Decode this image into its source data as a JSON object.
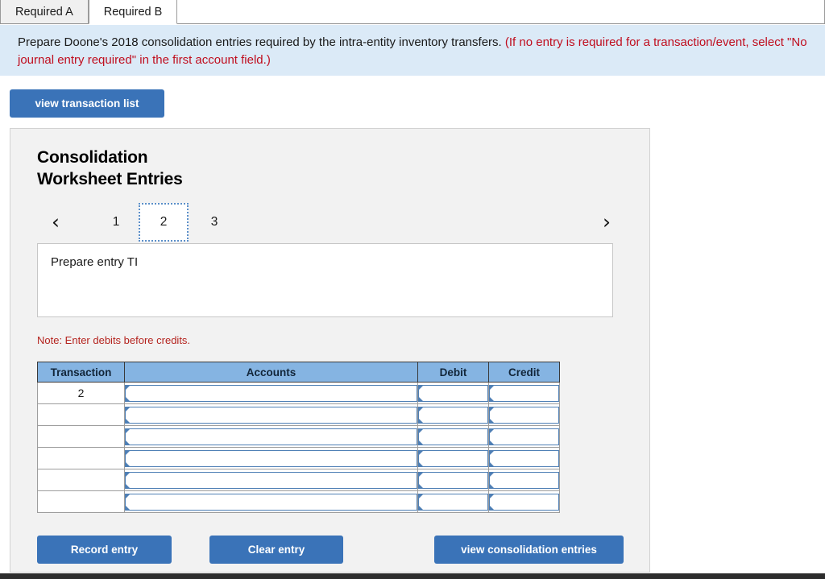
{
  "tabs": [
    {
      "label": "Required A",
      "active": false
    },
    {
      "label": "Required B",
      "active": true
    }
  ],
  "banner": {
    "black_text": "Prepare Doone's 2018 consolidation entries required by the intra-entity inventory transfers.",
    "red_text": "(If no entry is required for a transaction/event, select \"No journal entry required\" in the first account field.)"
  },
  "toolbar": {
    "view_transaction_list_label": "view transaction list"
  },
  "panel": {
    "title_line1": "Consolidation",
    "title_line2": "Worksheet Entries",
    "pager": {
      "prev_icon": "chevron-left-icon",
      "next_icon": "chevron-right-icon",
      "prev_glyph": "‹",
      "next_glyph": "›",
      "pages": [
        "1",
        "2",
        "3"
      ],
      "current": "2"
    },
    "entry_instruction": "Prepare entry TI",
    "note": "Note: Enter debits before credits.",
    "table": {
      "headers": [
        "Transaction",
        "Accounts",
        "Debit",
        "Credit"
      ],
      "rows": [
        {
          "transaction": "2",
          "accounts": "",
          "debit": "",
          "credit": ""
        },
        {
          "transaction": "",
          "accounts": "",
          "debit": "",
          "credit": ""
        },
        {
          "transaction": "",
          "accounts": "",
          "debit": "",
          "credit": ""
        },
        {
          "transaction": "",
          "accounts": "",
          "debit": "",
          "credit": ""
        },
        {
          "transaction": "",
          "accounts": "",
          "debit": "",
          "credit": ""
        },
        {
          "transaction": "",
          "accounts": "",
          "debit": "",
          "credit": ""
        }
      ]
    },
    "actions": {
      "record_entry_label": "Record entry",
      "clear_entry_label": "Clear entry",
      "view_consolidation_entries_label": "view consolidation entries"
    }
  },
  "colors": {
    "accent_blue": "#3a73b8",
    "banner_bg": "#dbeaf7",
    "table_header_blue": "#85b4e2",
    "red_text": "#c00d1e",
    "note_red": "#b5241f",
    "panel_bg": "#f2f2f2"
  }
}
